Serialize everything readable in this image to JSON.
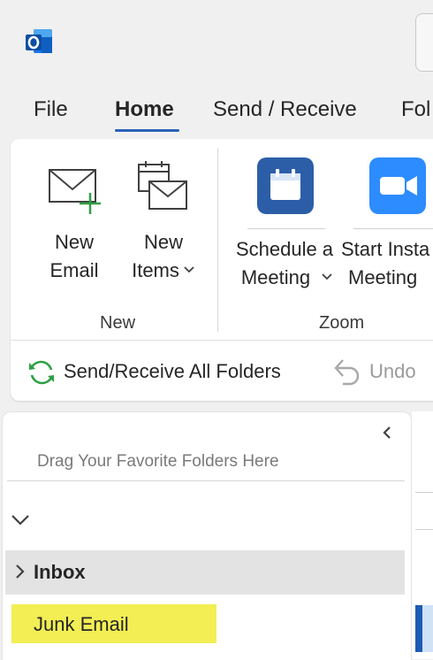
{
  "app": {
    "icon": "outlook-logo-icon"
  },
  "tabs": [
    {
      "label": "File",
      "active": false
    },
    {
      "label": "Home",
      "active": true
    },
    {
      "label": "Send / Receive",
      "active": false
    },
    {
      "label": "Fol",
      "active": false
    }
  ],
  "ribbon": {
    "new_group": {
      "label": "New",
      "new_email": {
        "line1": "New",
        "line2": "Email",
        "icon": "new-email-icon"
      },
      "new_items": {
        "line1": "New",
        "line2": "Items",
        "icon": "new-items-icon",
        "dropdown": "chevron-down-icon"
      }
    },
    "zoom_group": {
      "label": "Zoom",
      "schedule_meeting": {
        "line1": "Schedule a",
        "line2": "Meeting",
        "icon": "calendar-icon",
        "dropdown": "chevron-down-icon"
      },
      "start_instant": {
        "line1": "Start Insta",
        "line2": "Meeting",
        "icon": "video-camera-icon"
      }
    },
    "quick": {
      "send_receive_label": "Send/Receive All Folders",
      "undo_label": "Undo"
    }
  },
  "folder_pane": {
    "drag_hint": "Drag Your Favorite Folders Here",
    "folders": [
      {
        "label": "Inbox",
        "expandable": true
      },
      {
        "label": "Junk Email",
        "highlighted": true
      }
    ]
  },
  "colors": {
    "accent": "#2b61b9",
    "zoom_blue": "#2d8cff",
    "calendar_blue": "#2c5ea8",
    "highlight_yellow": "#f2ee54"
  }
}
